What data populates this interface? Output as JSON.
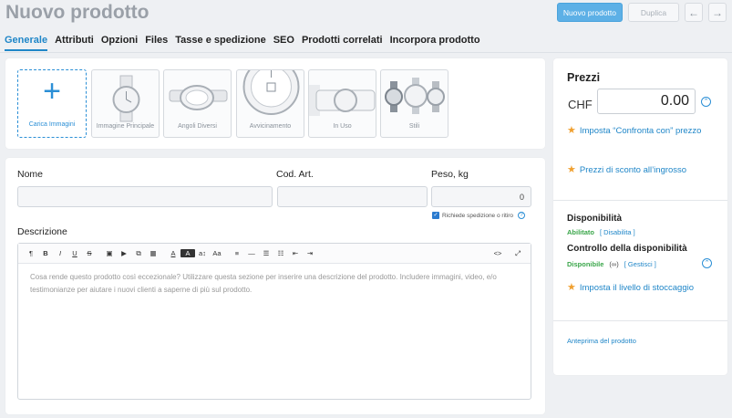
{
  "header": {
    "title": "Nuovo prodotto",
    "new_product_label": "Nuovo prodotto",
    "duplicate_label": "Duplica",
    "prev_icon": "arrow-left-icon",
    "next_icon": "arrow-right-icon"
  },
  "tabs": [
    {
      "label": "Generale"
    },
    {
      "label": "Attributi"
    },
    {
      "label": "Opzioni"
    },
    {
      "label": "Files"
    },
    {
      "label": "Tasse e spedizione"
    },
    {
      "label": "SEO"
    },
    {
      "label": "Prodotti correlati"
    },
    {
      "label": "Incorpora prodotto"
    }
  ],
  "images": {
    "upload_label": "Carica Immagini",
    "thumbs": [
      {
        "label": "Immagine Principale"
      },
      {
        "label": "Angoli Diversi"
      },
      {
        "label": "Avvicinamento"
      },
      {
        "label": "In Uso"
      },
      {
        "label": "Stili"
      }
    ]
  },
  "form": {
    "name_label": "Nome",
    "name_value": "",
    "sku_label": "Cod. Art.",
    "sku_value": "",
    "weight_label": "Peso, kg",
    "weight_value": "0",
    "shipping_label": "Richiede spedizione o ritiro",
    "description_label": "Descrizione",
    "description_placeholder": "Cosa rende questo prodotto così eccezionale? Utilizzare questa sezione per inserire una descrizione del prodotto. Includere immagini, video, e/o testimonianze per aiutare i nuovi clienti a saperne di più sul prodotto.",
    "toolbar": [
      "¶",
      "B",
      "I",
      "U",
      "S",
      "img",
      "vid",
      "emb",
      "tbl",
      "A",
      "A",
      "a",
      "Aa",
      "≡",
      "—",
      "•",
      "1.",
      "⇤",
      "⇥"
    ],
    "toolbar_right": [
      "<>",
      "⤢"
    ]
  },
  "sidebar": {
    "prices_title": "Prezzi",
    "currency": "CHF",
    "price_value": "0.00",
    "compare_label": "Imposta “Confronta con” prezzo",
    "bulk_discount_label": "Prezzi di sconto all’ingrosso",
    "availability_title": "Disponibilità",
    "availability_status": "Abilitato",
    "availability_action": "[ Disabilita ]",
    "stock_title": "Controllo della disponibilità",
    "stock_status": "Disponibile",
    "stock_qty": "(∞)",
    "stock_action": "[ Gestisci ]",
    "stock_level_label": "Imposta il livello di stoccaggio",
    "preview_label": "Anteprima del prodotto"
  },
  "colors": {
    "accent": "#1f86c8",
    "primary_button": "#5db0e6",
    "star": "#f0a030",
    "enabled": "#3aa64a"
  }
}
